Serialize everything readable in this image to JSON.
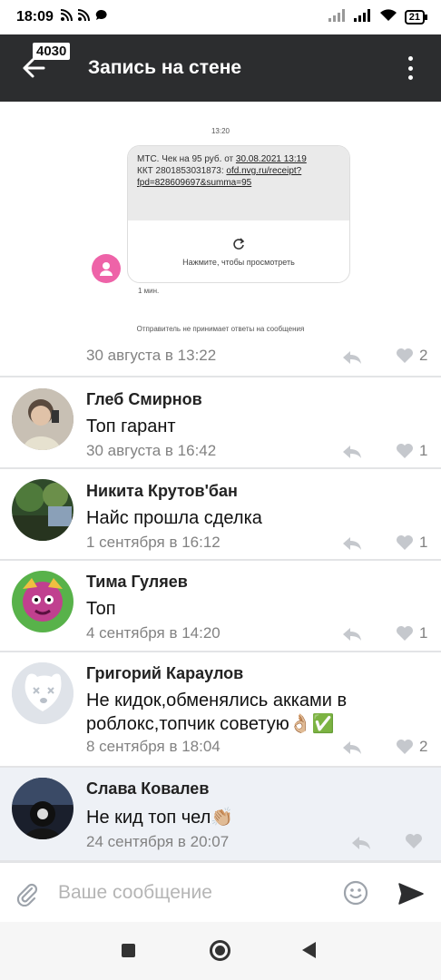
{
  "status": {
    "time": "18:09",
    "battery": "21"
  },
  "header": {
    "badge": "4030",
    "title": "Запись на стене"
  },
  "post_image": {
    "time": "13:20",
    "message_line1": "МТС. Чек на 95 руб. от ",
    "message_date": "30.08.2021 13:19",
    "message_line2": "ККТ 2801853031873: ",
    "message_link": "ofd.nvg.ru/receipt?fpd=828609697&summa=95",
    "tap_to_view": "Нажмите, чтобы просмотреть",
    "age": "1 мин.",
    "footer": "Отправитель не принимает ответы на сообщения"
  },
  "post": {
    "date": "30 августа в 13:22",
    "likes": "2"
  },
  "comments": [
    {
      "name": "Глеб Смирнов",
      "text": "Топ гарант",
      "date": "30 августа в 16:42",
      "likes": "1"
    },
    {
      "name": "Никита Крутов'бан",
      "text": "Найс прошла сделка",
      "date": "1 сентября в 16:12",
      "likes": "1"
    },
    {
      "name": "Тима Гуляев",
      "text": "Топ",
      "date": "4 сентября в 14:20",
      "likes": "1"
    },
    {
      "name": "Григорий Караулов",
      "text": "Не кидок,обменялись акками в роблокс,топчик советую👌🏼✅",
      "date": "8 сентября в 18:04",
      "likes": "2"
    },
    {
      "name": "Слава Ковалев",
      "text": "Не кид топ чел👏🏼",
      "date": "24 сентября в 20:07",
      "likes": ""
    }
  ],
  "composer": {
    "placeholder": "Ваше сообщение"
  },
  "colors": {
    "appbar": "#2c2d2f",
    "meta": "#828282",
    "highlight": "#eef1f6",
    "pink": "#ee63a8"
  }
}
